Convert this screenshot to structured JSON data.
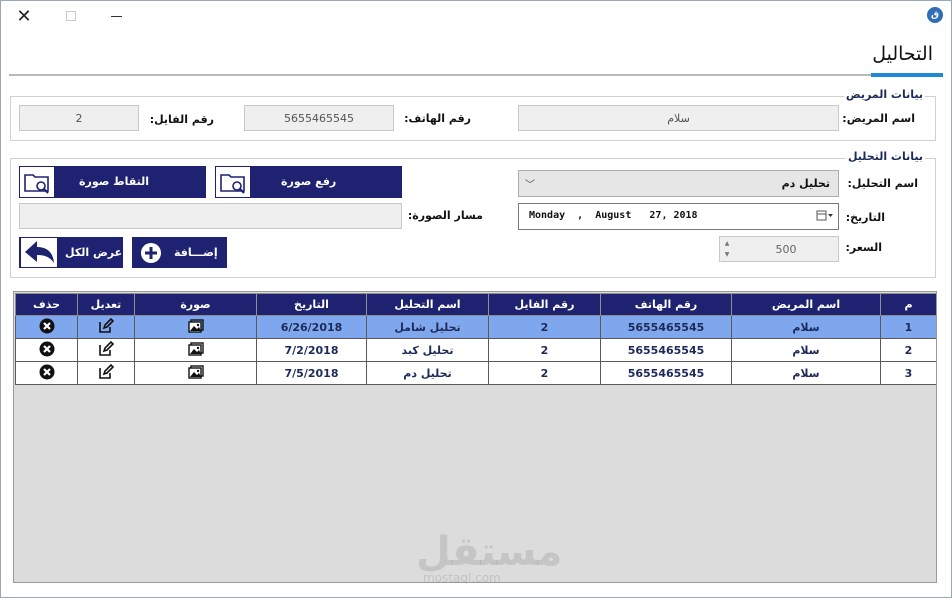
{
  "window": {
    "close_glyph": "✕",
    "app_icon_glyph": "ق"
  },
  "page": {
    "title": "التحاليل"
  },
  "patient_group": {
    "legend": "بيانات المريض",
    "name_label": "اسم المريض:",
    "name_value": "سلام",
    "phone_label": "رقم الهاتف:",
    "phone_value": "5655465545",
    "file_label": "رقم الفايل:",
    "file_value": "2"
  },
  "analysis_group": {
    "legend": "بيانات التحليل",
    "analysis_label": "اسم التحليل:",
    "analysis_value": "تحليل دم",
    "date_label": "التاريخ:",
    "date_value": "Monday  ,  August   27, 2018",
    "price_label": "السعر:",
    "price_value": "500",
    "image_path_label": "مسار الصورة:",
    "image_path_value": "",
    "upload_label": "رفع صورة",
    "capture_label": "التقاط صورة",
    "add_label": "إضـــافة",
    "show_all_label": "عرض الكل"
  },
  "table": {
    "columns": [
      "م",
      "اسم المريض",
      "رقم الهاتف",
      "رقم الفايل",
      "اسم التحليل",
      "التاريخ",
      "صورة",
      "تعديل",
      "حذف"
    ],
    "rows": [
      [
        "1",
        "سلام",
        "5655465545",
        "2",
        "تحليل شامل",
        "6/26/2018"
      ],
      [
        "2",
        "سلام",
        "5655465545",
        "2",
        "تحليل كبد",
        "7/2/2018"
      ],
      [
        "3",
        "سلام",
        "5655465545",
        "2",
        "تحليل دم",
        "7/5/2018"
      ]
    ],
    "selected_row": 0
  },
  "watermark": {
    "text": "مستقل",
    "sub": "mostaql.com"
  },
  "colors": {
    "navy": "#1e2270",
    "accent": "#1e88d8",
    "selected_row": "#7fa7ee"
  },
  "icons": {
    "image_cell": "picture-icon",
    "edit_cell": "edit-icon",
    "delete_cell": "delete-icon"
  }
}
